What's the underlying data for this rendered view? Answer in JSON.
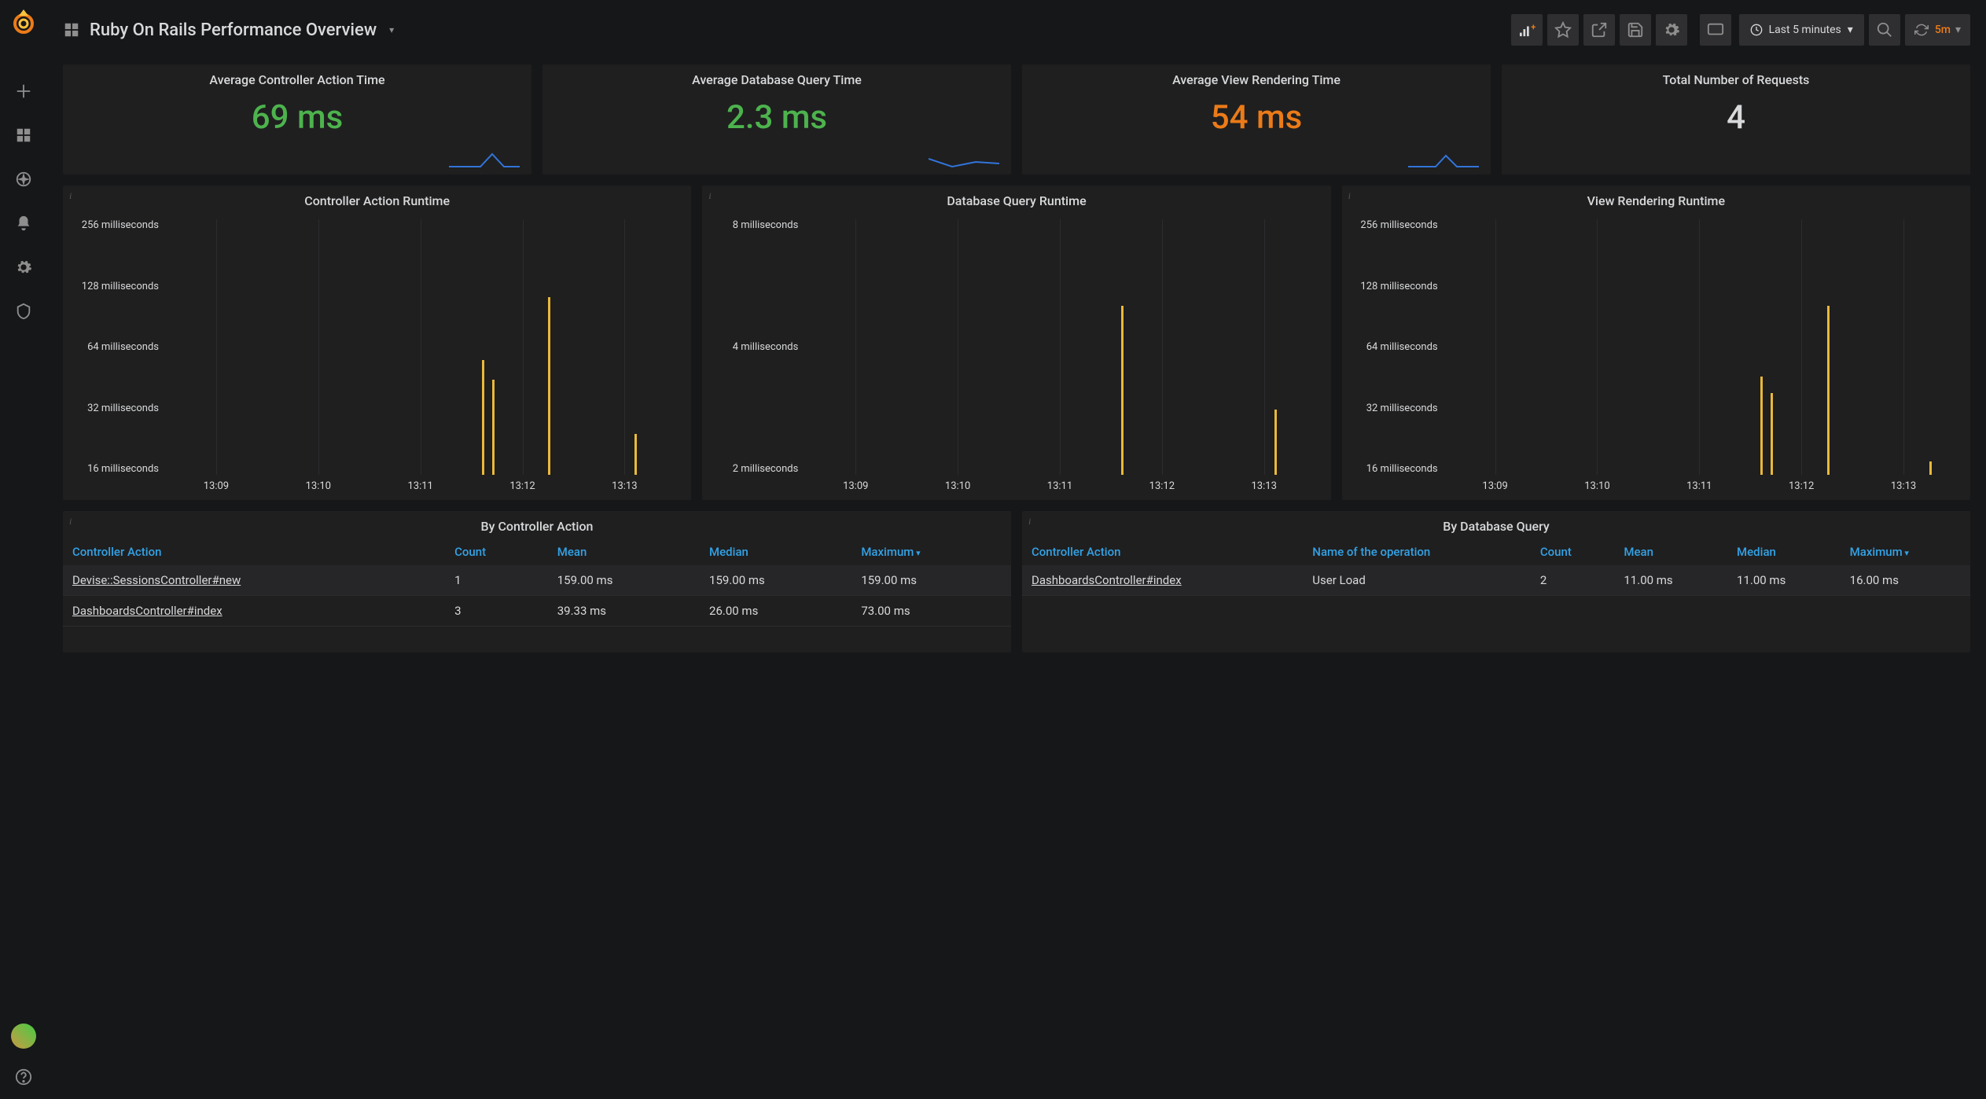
{
  "header": {
    "title": "Ruby On Rails Performance Overview",
    "time_range": "Last 5 minutes",
    "refresh_interval": "5m"
  },
  "stats": [
    {
      "title": "Average Controller Action Time",
      "value": "69 ms",
      "color": "green"
    },
    {
      "title": "Average Database Query Time",
      "value": "2.3 ms",
      "color": "green"
    },
    {
      "title": "Average View Rendering Time",
      "value": "54 ms",
      "color": "orange"
    },
    {
      "title": "Total Number of Requests",
      "value": "4",
      "color": "white"
    }
  ],
  "charts": [
    {
      "title": "Controller Action Runtime",
      "y_ticks": [
        "256 milliseconds",
        "128 milliseconds",
        "64 milliseconds",
        "32 milliseconds",
        "16 milliseconds"
      ],
      "x_ticks": [
        "13:09",
        "13:10",
        "13:11",
        "13:12",
        "13:13"
      ],
      "bars": [
        {
          "x_pct": 62,
          "h_pct": 42
        },
        {
          "x_pct": 64,
          "h_pct": 35
        },
        {
          "x_pct": 75,
          "h_pct": 65
        },
        {
          "x_pct": 92,
          "h_pct": 15
        }
      ]
    },
    {
      "title": "Database Query Runtime",
      "y_ticks": [
        "8 milliseconds",
        "4 milliseconds",
        "2 milliseconds"
      ],
      "x_ticks": [
        "13:09",
        "13:10",
        "13:11",
        "13:12",
        "13:13"
      ],
      "bars": [
        {
          "x_pct": 62,
          "h_pct": 62
        },
        {
          "x_pct": 92,
          "h_pct": 24
        }
      ]
    },
    {
      "title": "View Rendering Runtime",
      "y_ticks": [
        "256 milliseconds",
        "128 milliseconds",
        "64 milliseconds",
        "32 milliseconds",
        "16 milliseconds"
      ],
      "x_ticks": [
        "13:09",
        "13:10",
        "13:11",
        "13:12",
        "13:13"
      ],
      "bars": [
        {
          "x_pct": 62,
          "h_pct": 36
        },
        {
          "x_pct": 64,
          "h_pct": 30
        },
        {
          "x_pct": 75,
          "h_pct": 62
        },
        {
          "x_pct": 95,
          "h_pct": 5
        }
      ]
    }
  ],
  "tables": {
    "by_controller": {
      "title": "By Controller Action",
      "headers": [
        "Controller Action",
        "Count",
        "Mean",
        "Median",
        "Maximum"
      ],
      "sorted_col": 4,
      "rows": [
        [
          "Devise::SessionsController#new",
          "1",
          "159.00 ms",
          "159.00 ms",
          "159.00 ms"
        ],
        [
          "DashboardsController#index",
          "3",
          "39.33 ms",
          "26.00 ms",
          "73.00 ms"
        ]
      ]
    },
    "by_query": {
      "title": "By Database Query",
      "headers": [
        "Controller Action",
        "Name of the operation",
        "Count",
        "Mean",
        "Median",
        "Maximum"
      ],
      "sorted_col": 5,
      "rows": [
        [
          "DashboardsController#index",
          "User Load",
          "2",
          "11.00 ms",
          "11.00 ms",
          "16.00 ms"
        ]
      ]
    }
  },
  "chart_data": [
    {
      "type": "bar",
      "title": "Controller Action Runtime",
      "x": [
        "13:12",
        "13:12",
        "13:12",
        "13:13"
      ],
      "values_ms": [
        52,
        42,
        160,
        22
      ],
      "yscale": "log2",
      "ylim_ms": [
        16,
        256
      ]
    },
    {
      "type": "bar",
      "title": "Database Query Runtime",
      "x": [
        "13:12",
        "13:13"
      ],
      "values_ms": [
        5.0,
        2.6
      ],
      "yscale": "log2",
      "ylim_ms": [
        2,
        8
      ]
    },
    {
      "type": "bar",
      "title": "View Rendering Runtime",
      "x": [
        "13:12",
        "13:12",
        "13:12",
        "13:13"
      ],
      "values_ms": [
        44,
        38,
        140,
        17
      ],
      "yscale": "log2",
      "ylim_ms": [
        16,
        256
      ]
    }
  ]
}
